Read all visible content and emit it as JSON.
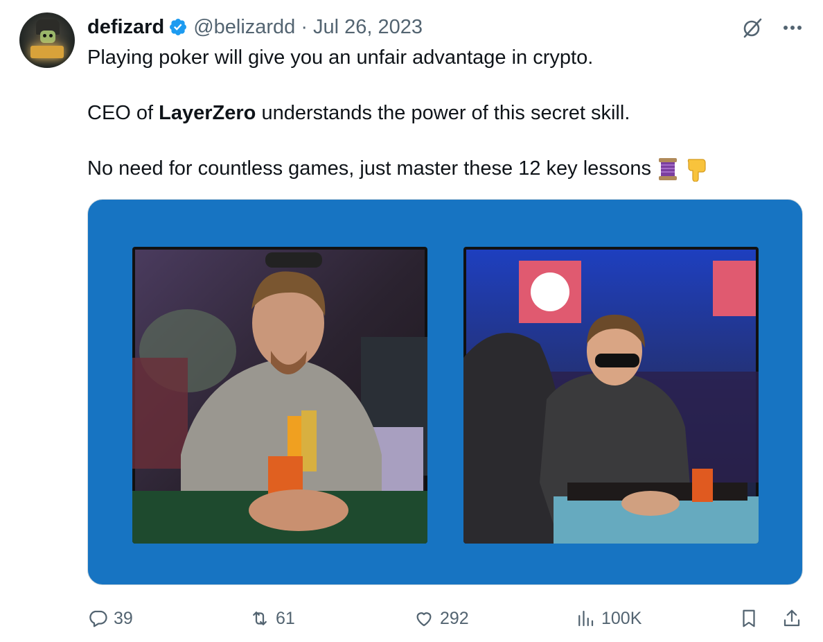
{
  "tweet": {
    "author_name": "defizard",
    "handle": "@belizardd",
    "separator": "·",
    "date": "Jul 26, 2023",
    "line1": "Playing poker will give you an unfair advantage in crypto.",
    "line2_prefix": "CEO of ",
    "line2_bold": "LayerZero",
    "line2_suffix": " understands the power of this secret skill.",
    "line3": "No need for countless games, just master these 12 key lessons",
    "line3_emojis": [
      "thread-emoji",
      "pointing-down-emoji"
    ]
  },
  "media": {
    "background_color": "#1774c2",
    "images": [
      "poker-player-photo-left",
      "poker-player-photo-right"
    ]
  },
  "actions": {
    "replies": "39",
    "reposts": "61",
    "likes": "292",
    "views": "100K"
  },
  "colors": {
    "text": "#0f1419",
    "secondary": "#536471",
    "verified": "#1d9bf0"
  }
}
